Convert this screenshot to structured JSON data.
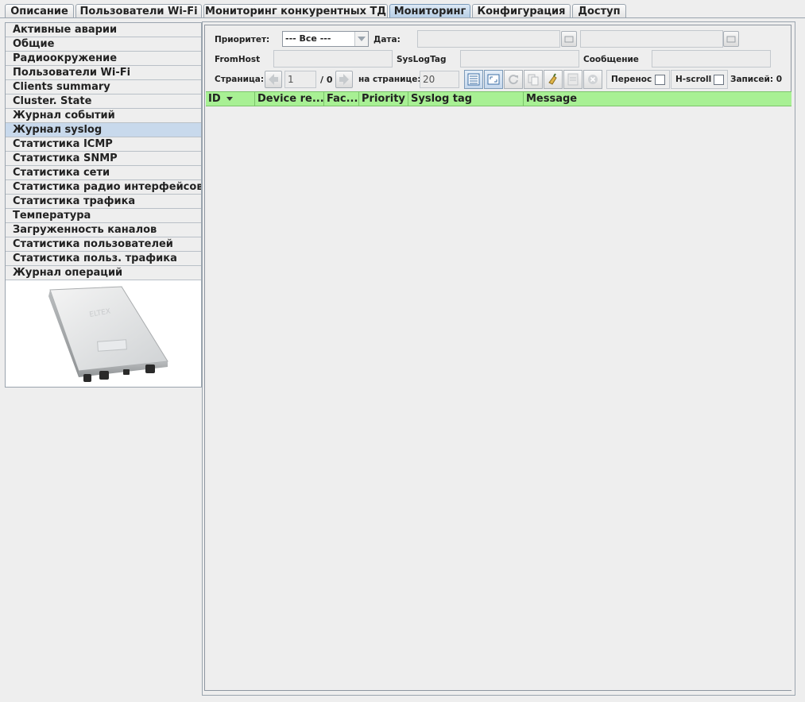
{
  "tabs": [
    {
      "label": "Описание"
    },
    {
      "label": "Пользователи Wi-Fi"
    },
    {
      "label": "Мониторинг конкурентных ТД"
    },
    {
      "label": "Мониторинг"
    },
    {
      "label": "Конфигурация"
    },
    {
      "label": "Доступ"
    }
  ],
  "menu": [
    {
      "label": "Активные аварии"
    },
    {
      "label": "Общие"
    },
    {
      "label": "Радиоокружение"
    },
    {
      "label": "Пользователи Wi-Fi"
    },
    {
      "label": "Clients summary"
    },
    {
      "label": "Cluster. State"
    },
    {
      "label": "Журнал событий"
    },
    {
      "label": "Журнал syslog"
    },
    {
      "label": "Статистика ICMP"
    },
    {
      "label": "Статистика SNMP"
    },
    {
      "label": "Статистика сети"
    },
    {
      "label": "Статистика радио интерфейсов"
    },
    {
      "label": "Статистика трафика"
    },
    {
      "label": "Температура"
    },
    {
      "label": "Загруженность каналов"
    },
    {
      "label": "Статистика пользователей"
    },
    {
      "label": "Статистика польз. трафика"
    },
    {
      "label": "Журнал операций"
    }
  ],
  "filters": {
    "priority_label": "Приоритет:",
    "priority_value": "--- Все ---",
    "date_label": "Дата:",
    "fromhost_label": "FromHost",
    "syslogtag_label": "SysLogTag",
    "message_label": "Сообщение"
  },
  "pager": {
    "page_label": "Страница:",
    "page_value": "1",
    "page_total": "/ 0",
    "per_page_label": "на странице:",
    "per_page_value": "20",
    "wrap_label": "Перенос",
    "hscroll_label": "H-scroll",
    "records_label": "Записей: 0"
  },
  "grid": {
    "columns": [
      "ID",
      "Device re...",
      "Fac...",
      "Priority",
      "Syslog tag",
      "Message"
    ]
  },
  "colors": {
    "grid_header": "#a8f094",
    "selected_menu": "#c8d9ec",
    "active_tab": "#b8cfe6"
  }
}
